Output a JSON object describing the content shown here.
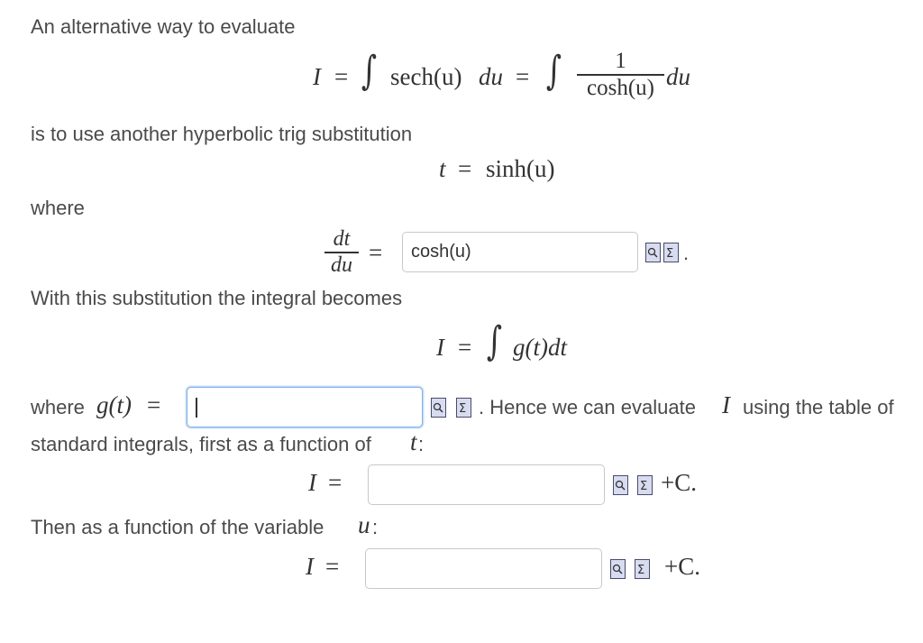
{
  "text": {
    "intro": "An alternative way to evaluate",
    "is_to_use": "is to use another hyperbolic trig substitution",
    "where": "where",
    "with_this": "With this substitution the integral becomes",
    "where_g_prefix": "where",
    "hence": ". Hence we can evaluate",
    "using_table": "using the table of",
    "standard": "standard integrals, first as a function of",
    "colon1": ":",
    "then_as": "Then as a function of the variable",
    "colon2": ":",
    "period_after_icons": "."
  },
  "math": {
    "I": "I",
    "equals": "=",
    "sech_u": "sech(u)",
    "du": "du",
    "frac_num": "1",
    "frac_den": "cosh(u)",
    "t_eq": "t",
    "sinh_u": "sinh(u)",
    "dt": "dt",
    "du_den": "du",
    "g_t": "g(t)",
    "g_t_dt": "g(t)dt",
    "t_var": "t",
    "u_var": "u",
    "plus_c": "+C."
  },
  "inputs": {
    "dtdu_value": "cosh(u)",
    "g_value": "",
    "I_t_value": "",
    "I_u_value": ""
  },
  "icons": {
    "preview": "preview-icon",
    "equation_editor": "equation-editor-icon"
  },
  "colors": {
    "text": "#4a4a4a",
    "focus_border": "#7eaee8",
    "icon_fill": "#d8dcf0"
  }
}
